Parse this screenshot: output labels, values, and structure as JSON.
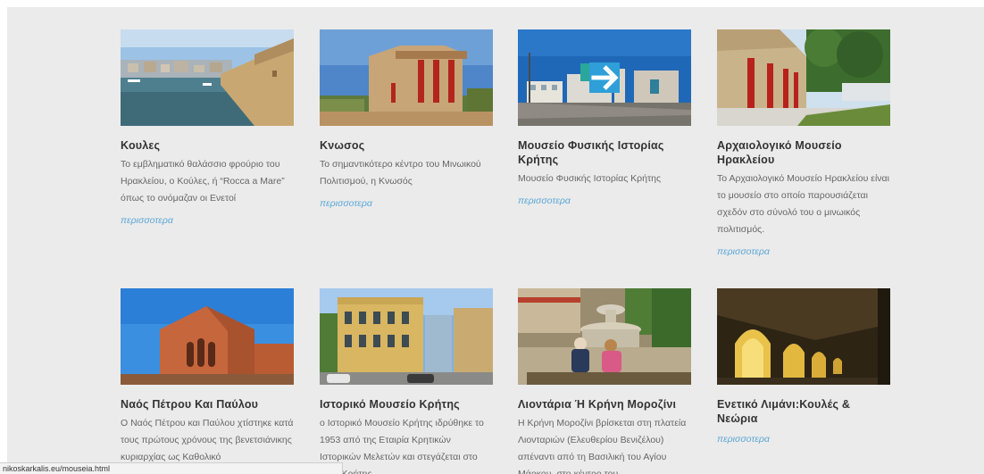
{
  "cards": [
    {
      "title": "Κουλες",
      "description": "Το εμβληματικό θαλάσσιο φρούριο του Ηρακλείου, ο Κούλες, ή “Rocca a Mare” όπως το ονόμαζαν οι Ενετοί",
      "more": "περισσοτερα"
    },
    {
      "title": "Κνωσος",
      "description": "Το σημαντικότερο κέντρο του Μινωικού Πολιτισμού, η Κνωσός",
      "more": "περισσοτερα"
    },
    {
      "title": "Μουσείο Φυσικής Ιστορίας Κρήτης",
      "description": "Μουσείο Φυσικής Ιστορίας Κρήτης",
      "more": "περισσοτερα"
    },
    {
      "title": "Αρχαιολογικό Μουσείο Ηρακλείου",
      "description": "Το Αρχαιολογικό Μουσείο Ηρακλείου είναι το μουσείο στο οποίο παρουσιάζεται σχεδόν στο σύνολό του ο μινωικός πολιτισμός.",
      "more": "περισσοτερα"
    },
    {
      "title": "Ναός Πέτρου Και Παύλου",
      "description": "Ο Ναός Πέτρου και Παύλου χτίστηκε κατά τους πρώτους χρόνους της βενετσιάνικης κυριαρχίας ως Καθολικό",
      "more": ""
    },
    {
      "title": "Ιστορικό Μουσείο Κρήτης",
      "description": "ο Ιστορικό Μουσείο Κρήτης ιδρύθηκε το 1953 από της Εταιρία Κρητικών Ιστορικών Μελετών και στεγάζεται στο ...είο Κρήτης",
      "more": ""
    },
    {
      "title": "Λιοντάρια Ή Κρήνη Μοροζίνι",
      "description": "Η Κρήνη Μοροζίνι βρίσκεται στη πλατεία Λιονταριών (Ελευθερίου Βενιζέλου) απέναντι από τη Βασιλική του Αγίου Μάρκου, στο κέντρο του",
      "more": ""
    },
    {
      "title": "Ενετικό Λιμάνι:Κουλές & Νεώρια",
      "description": "",
      "more": "περισσοτερα"
    }
  ],
  "status_bar": {
    "url": "nikoskarkalis.eu/mouseia.html"
  },
  "icons": {
    "hover": "arrow-right-icon"
  },
  "colors": {
    "link": "#5aa6d6",
    "accent": "#2e9fd8",
    "background": "#ebebeb"
  }
}
